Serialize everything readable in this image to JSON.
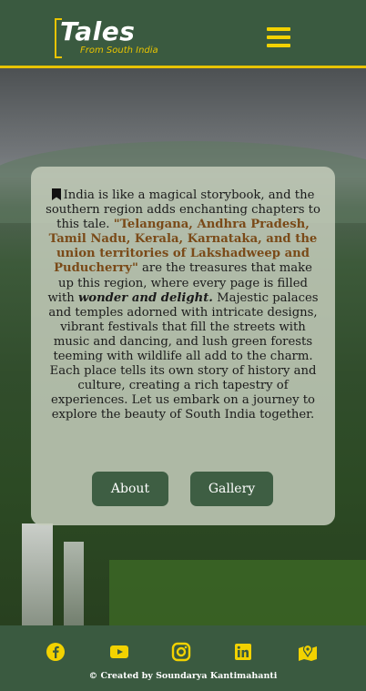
{
  "header": {
    "logo_title": "Tales",
    "logo_subtitle": "From South India",
    "menu_icon": "hamburger-menu-icon"
  },
  "intro": {
    "bookmark_icon": "bookmark-icon",
    "text1": "India is like a magical storybook, and the southern region adds enchanting chapters to this tale. ",
    "highlight": "\"Telangana, Andhra Pradesh, Tamil Nadu, Kerala, Karnataka, and the union territories of Lakshadweep and Puducherry\"",
    "text2": " are the treasures that make up this region, where every page is filled with ",
    "emphasis": "wonder and delight.",
    "text3": " Majestic palaces and temples adorned with intricate designs, vibrant festivals that fill the streets with music and dancing, and lush green forests teeming with wildlife all add to the charm. Each place tells its own story of history and culture, creating a rich tapestry of experiences. Let us embark on a journey to explore the beauty of South India together."
  },
  "buttons": {
    "about": "About",
    "gallery": "Gallery"
  },
  "footer": {
    "icons": [
      "facebook-icon",
      "youtube-icon",
      "instagram-icon",
      "linkedin-icon",
      "map-icon"
    ],
    "credit": "© Created by Soundarya Kantimahanti"
  },
  "colors": {
    "primary_green": "#3a5a40",
    "accent_yellow": "#e8c400",
    "highlight_brown": "#7a4a18"
  }
}
